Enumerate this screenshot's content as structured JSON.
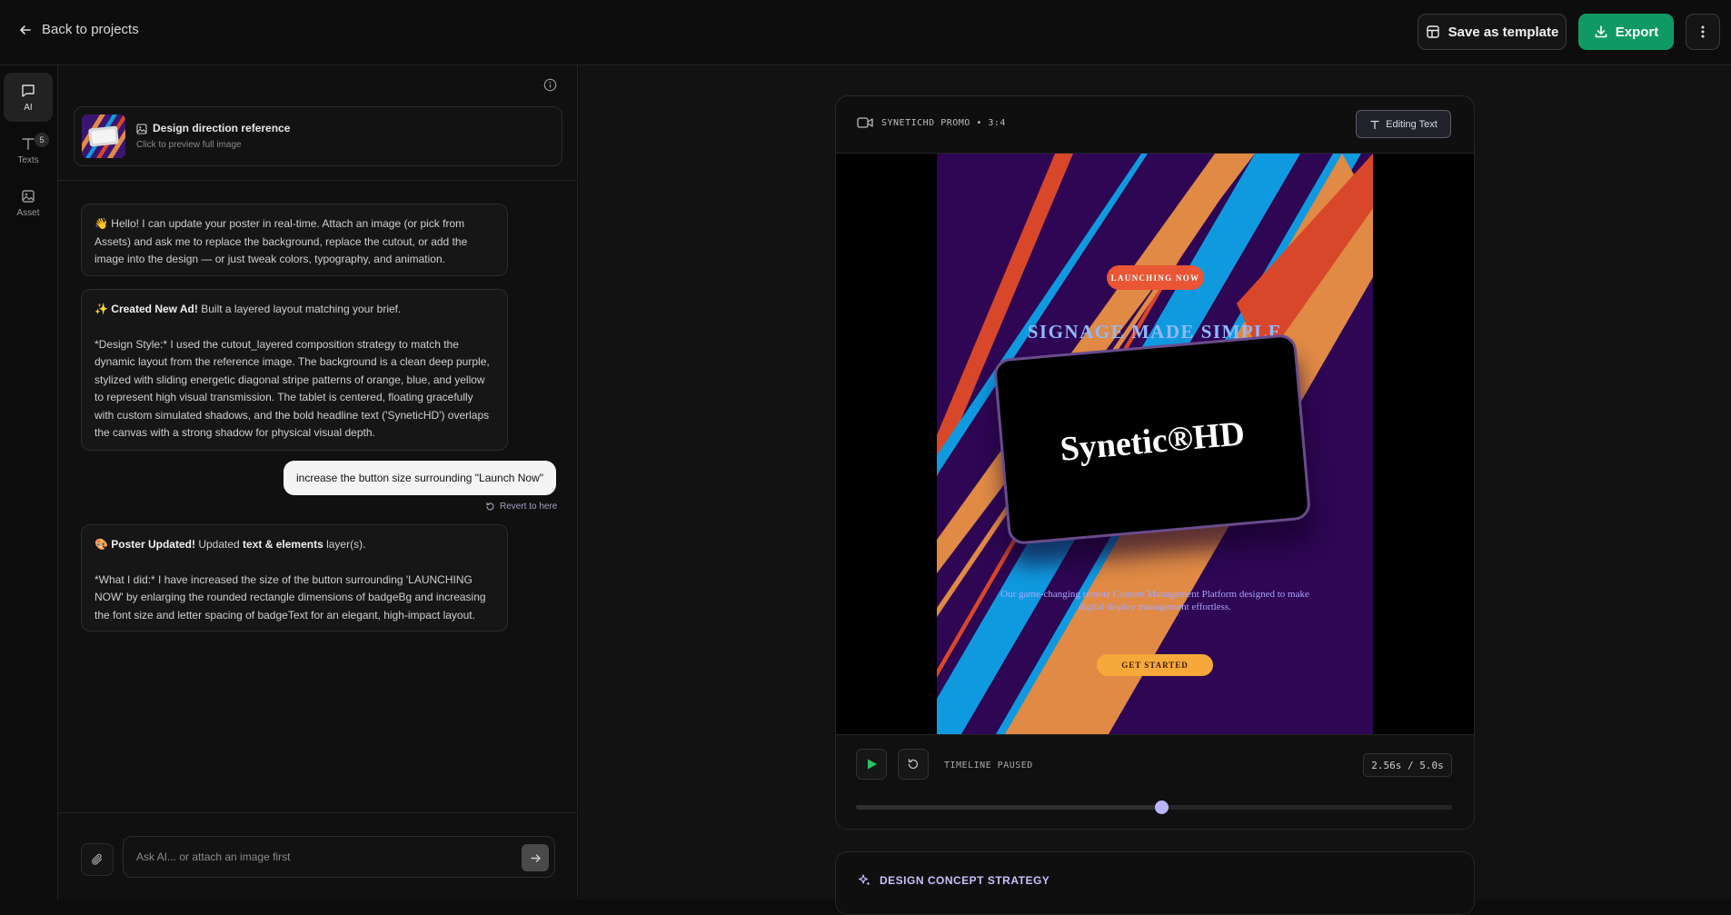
{
  "header": {
    "back_label": "Back to projects",
    "save_template_label": "Save as template",
    "export_label": "Export"
  },
  "rail": {
    "items": [
      {
        "label": "AI",
        "icon": "chat-icon",
        "active": true
      },
      {
        "label": "Texts",
        "icon": "text-icon",
        "badge": "5"
      },
      {
        "label": "Asset",
        "icon": "image-icon"
      }
    ]
  },
  "chat": {
    "reference": {
      "title": "Design direction reference",
      "subtitle": "Click to preview full image"
    },
    "messages": [
      {
        "role": "assistant",
        "emoji": "👋",
        "text": "Hello! I can update your poster in real-time. Attach an image (or pick from Assets) and ask me to replace the background, replace the cutout, or add the image into the design — or just tweak colors, typography, and animation."
      },
      {
        "role": "assistant",
        "emoji": "✨",
        "heading": "Created New Ad!",
        "text": "Built a layered layout matching your brief.",
        "detail": "*Design Style:* I used the cutout_layered composition strategy to match the dynamic layout from the reference image. The background is a clean deep purple, stylized with sliding energetic diagonal stripe patterns of orange, blue, and yellow to represent high visual transmission. The tablet is centered, floating gracefully with custom simulated shadows, and the bold headline text ('SyneticHD') overlaps the canvas with a strong shadow for physical visual depth."
      },
      {
        "role": "user",
        "text": "increase the button size surrounding \"Launch Now\""
      },
      {
        "role": "assistant",
        "emoji": "🎨",
        "heading": "Poster Updated!",
        "text_pre": "Updated",
        "text_bold": "text & elements",
        "text_post": "layer(s).",
        "detail": "*What I did:* I have increased the size of the button surrounding 'LAUNCHING NOW' by enlarging the rounded rectangle dimensions of badgeBg and increasing the font size and letter spacing of badgeText for an elegant, high-impact layout."
      }
    ],
    "revert_label": "Revert to here",
    "composer": {
      "placeholder": "Ask AI... or attach an image first"
    }
  },
  "preview": {
    "title": "SYNETICHD PROMO • 3:4",
    "editing_label": "Editing Text",
    "poster": {
      "badge": "LAUNCHING NOW",
      "headline": "SIGNAGE MADE SIMPLE",
      "tablet_text": "Synetic®HD",
      "description": "Our game-changing remote Content Management Platform designed to make digital display management effortless.",
      "cta": "GET STARTED",
      "colors": {
        "background": "#2e0653",
        "stripe_orange": "#e08a45",
        "stripe_blue": "#0f9ae0",
        "stripe_red": "#d9472b",
        "badge": "#ea5534",
        "cta": "#f6a93a"
      }
    },
    "timeline": {
      "status": "TIMELINE PAUSED",
      "current": 2.56,
      "duration": 5.0,
      "time_label": "2.56s / 5.0s"
    }
  },
  "strategy": {
    "title": "DESIGN CONCEPT STRATEGY"
  },
  "accent": {
    "export_green": "#0f9a63",
    "lavender": "#b9b5ff"
  }
}
